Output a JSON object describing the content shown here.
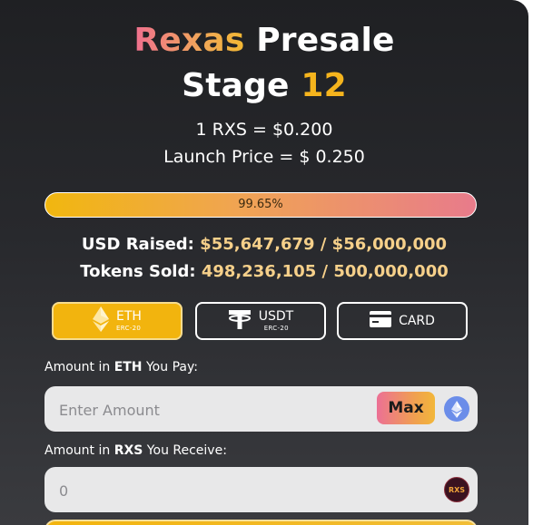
{
  "header": {
    "brand": "Rexas",
    "title_rest": "Presale",
    "stage_label": "Stage",
    "stage_number": "12"
  },
  "pricing": {
    "current_price": "1 RXS = $0.200",
    "launch_price": "Launch Price = $ 0.250"
  },
  "progress": {
    "percent_text": "99.65%",
    "fraction": 0.9965
  },
  "stats": {
    "usd_raised_label": "USD Raised:",
    "usd_raised_value": "$55,647,679 / $56,000,000",
    "tokens_sold_label": "Tokens Sold:",
    "tokens_sold_value": "498,236,105 / 500,000,000"
  },
  "payment_methods": {
    "eth_label": "ETH",
    "eth_sub": "ERC-20",
    "usdt_label": "USDT",
    "usdt_sub": "ERC-20",
    "card_label": "CARD",
    "selected": "ETH"
  },
  "pay_field": {
    "label_prefix": "Amount in ",
    "currency": "ETH",
    "label_suffix": " You Pay:",
    "placeholder": "Enter Amount",
    "max_label": "Max"
  },
  "receive_field": {
    "label_prefix": "Amount in ",
    "currency": "RXS",
    "label_suffix": " You Receive:",
    "value": "0",
    "token_icon_text": "RXS"
  },
  "colors": {
    "accent_yellow": "#f2b40e",
    "accent_pink": "#ec7095",
    "value_gold": "#f6d08a",
    "background": "#28292d"
  }
}
